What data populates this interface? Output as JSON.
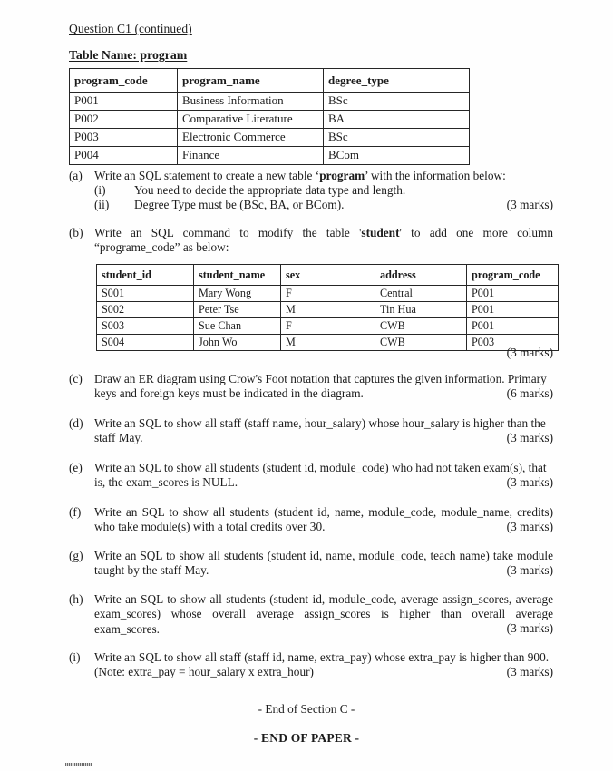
{
  "page": {
    "question_heading": "Question C1 (continued)",
    "table_title": "Table Name: program"
  },
  "program_table": {
    "headers": [
      "program_code",
      "program_name",
      "degree_type"
    ],
    "rows": [
      [
        "P001",
        "Business Information",
        "BSc"
      ],
      [
        "P002",
        "Comparative Literature",
        "BA"
      ],
      [
        "P003",
        "Electronic Commerce",
        "BSc"
      ],
      [
        "P004",
        "Finance",
        "BCom"
      ]
    ]
  },
  "student_table": {
    "headers": [
      "student_id",
      "student_name",
      "sex",
      "address",
      "program_code"
    ],
    "rows": [
      [
        "S001",
        "Mary Wong",
        "F",
        "Central",
        "P001"
      ],
      [
        "S002",
        "Peter Tse",
        "M",
        "Tin Hua",
        "P001"
      ],
      [
        "S003",
        "Sue Chan",
        "F",
        "CWB",
        "P001"
      ],
      [
        "S004",
        "John Wo",
        "M",
        "CWB",
        "P003"
      ]
    ]
  },
  "items": {
    "a": {
      "label": "(a)",
      "text_before_bold": "Write an SQL statement to create a new table ‘",
      "bold": "program",
      "text_after_bold": "’ with the information below:",
      "sub_i_num": "(i)",
      "sub_i_text": "You need to decide the appropriate data type and length.",
      "sub_ii_num": "(ii)",
      "sub_ii_text": "Degree Type must be (BSc, BA, or BCom).",
      "marks": "(3 marks)"
    },
    "b": {
      "label": "(b)",
      "text_before_bold": "Write an SQL command to modify the table '",
      "bold": "student",
      "text_after_bold": "' to add one more column “programe_code” as below:",
      "marks": "(3 marks)"
    },
    "c": {
      "label": "(c)",
      "text": "Draw an ER diagram using Crow's Foot notation that captures the given information.  Primary keys and foreign keys must be indicated in the diagram.",
      "marks": "(6 marks)"
    },
    "d": {
      "label": "(d)",
      "text": "Write an SQL to show all staff (staff name, hour_salary) whose hour_salary is higher than the staff May.",
      "marks": "(3 marks)"
    },
    "e": {
      "label": "(e)",
      "text": "Write an SQL to show all students (student id, module_code) who had not taken exam(s), that is, the exam_scores is NULL.",
      "marks": "(3 marks)"
    },
    "f": {
      "label": "(f)",
      "text": "Write an SQL to show all students (student id, name, module_code, module_name, credits) who take module(s) with a total credits over 30.",
      "marks": "(3 marks)"
    },
    "g": {
      "label": "(g)",
      "text": "Write an SQL to show all students (student id, name, module_code, teach name) take module taught by the staff May.",
      "marks": "(3 marks)"
    },
    "h": {
      "label": "(h)",
      "text": "Write an SQL to show all students (student id, module_code, average assign_scores, average exam_scores) whose overall average assign_scores is higher than overall average exam_scores.",
      "marks": "(3 marks)"
    },
    "i": {
      "label": "(i)",
      "text": "Write an SQL to show all staff (staff id, name, extra_pay) whose extra_pay is higher than 900.",
      "note": "(Note: extra_pay = hour_salary x extra_hour)",
      "marks": "(3 marks)"
    }
  },
  "footer": {
    "end_of_section": "- End of Section C -",
    "end_of_paper": "- END OF PAPER -"
  }
}
